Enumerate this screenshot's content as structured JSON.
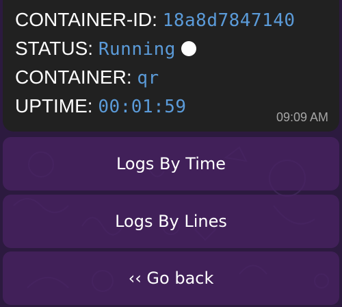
{
  "message": {
    "container_id_label": "CONTAINER-ID:",
    "container_id_value": "18a8d7847140",
    "status_label": "STATUS:",
    "status_value": "Running",
    "container_label": "CONTAINER:",
    "container_value": "qr",
    "uptime_label": "UPTIME:",
    "uptime_value": "00:01:59",
    "timestamp": "09:09 AM"
  },
  "keyboard": {
    "logs_by_time": "Logs By Time",
    "logs_by_lines": "Logs By Lines",
    "go_back": "‹‹ Go back"
  },
  "colors": {
    "background": "#2c1a3f",
    "bubble": "#212121",
    "value_text": "#5b9bd9",
    "button": "#4a2264"
  }
}
